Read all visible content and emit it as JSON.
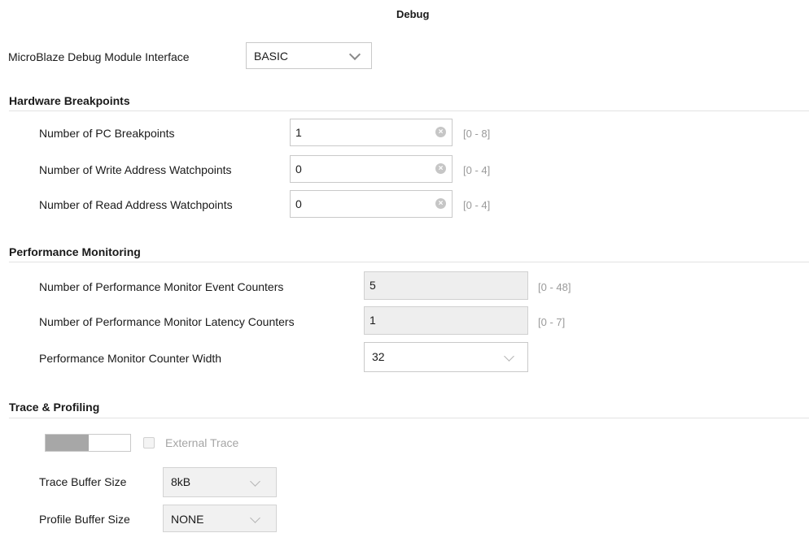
{
  "page": {
    "title": "Debug"
  },
  "mdm": {
    "label": "MicroBlaze Debug Module Interface",
    "value": "BASIC"
  },
  "hardware": {
    "heading": "Hardware Breakpoints",
    "rows": [
      {
        "label": "Number of PC Breakpoints",
        "value": "1",
        "range": "[0 - 8]"
      },
      {
        "label": "Number of Write Address Watchpoints",
        "value": "0",
        "range": "[0 - 4]"
      },
      {
        "label": "Number of Read Address Watchpoints",
        "value": "0",
        "range": "[0 - 4]"
      }
    ]
  },
  "performance": {
    "heading": "Performance Monitoring",
    "rows": [
      {
        "label": "Number of Performance Monitor Event Counters",
        "value": "5",
        "range": "[0 - 48]"
      },
      {
        "label": "Number of Performance Monitor Latency Counters",
        "value": "1",
        "range": "[0 - 7]"
      }
    ],
    "width": {
      "label": "Performance Monitor Counter Width",
      "value": "32"
    }
  },
  "trace": {
    "heading": "Trace & Profiling",
    "external_trace_label": "External Trace",
    "external_trace_checked": false,
    "trace_buffer": {
      "label": "Trace Buffer Size",
      "value": "8kB"
    },
    "profile_buffer": {
      "label": "Profile Buffer Size",
      "value": "NONE"
    }
  }
}
